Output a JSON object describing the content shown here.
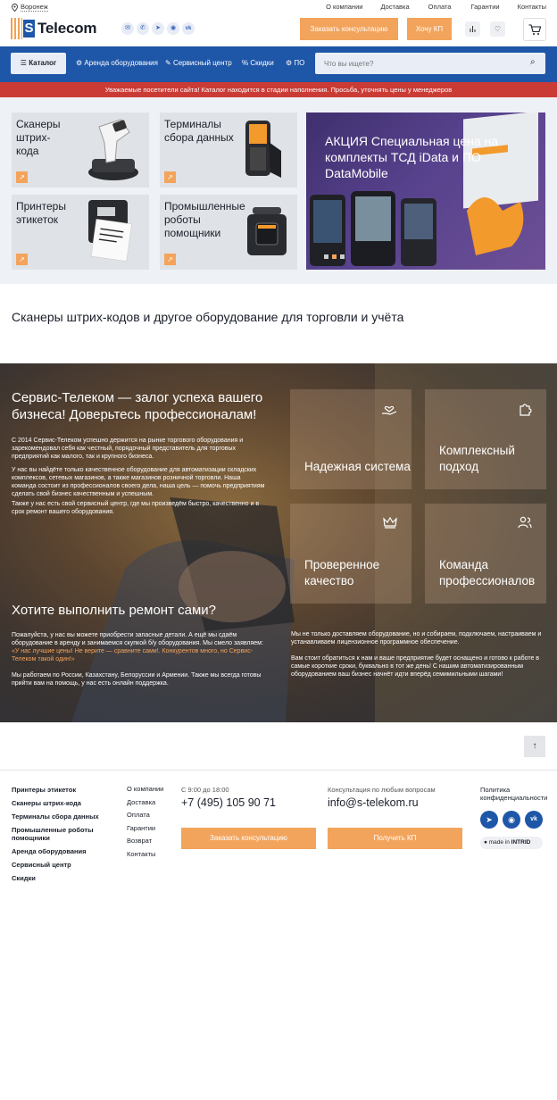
{
  "topbar": {
    "city": "Воронеж",
    "links": [
      "О компании",
      "Доставка",
      "Оплата",
      "Гарантии",
      "Контакты"
    ]
  },
  "header": {
    "logo_s": "S",
    "logo_text": "Telecom",
    "social_icons": [
      "mail-icon",
      "viber-icon",
      "telegram-icon",
      "whatsapp-icon",
      "vk-icon"
    ],
    "consult_button": "Заказать консультацию",
    "kp_button": "Хочу КП"
  },
  "nav": {
    "catalog": "Каталог",
    "items": [
      "Аренда оборудования",
      "Сервисный центр",
      "Скидки",
      "ПО"
    ],
    "search_placeholder": "Что вы ищете?"
  },
  "notice": "Уважаемые посетители сайта! Каталог находится в стадии наполнения. Просьба, уточнять цены у менеджеров",
  "categories": [
    {
      "title": "Сканеры штрих-кода"
    },
    {
      "title": "Терминалы сбора данных"
    },
    {
      "title": "Принтеры этикеток"
    },
    {
      "title": "Промышленные роботы помощники"
    }
  ],
  "promo": {
    "title": "АКЦИЯ Специальная цена на комплекты ТСД iData и ПО DataMobile",
    "slides": 3,
    "active_slide": 2
  },
  "tagline": "Сканеры штрих-кодов и другое оборудование для торговли и учёта",
  "about": {
    "hero": "Сервис-Телеком — залог успеха вашего бизнеса! Доверьтесь профессионалам!",
    "p1": "С 2014 Сервис-Телеком успешно держится на рынке торгового оборудования и зарекомендовал себя как честный, порядочный представитель для торговых предприятий как малого, так и крупного бизнеса.",
    "p2": "У нас вы найдёте только качественное оборудование для автоматизации складских комплексов, сетевых магазинов, а также магазинов розничной торговли. Наша команда состоит из профессионалов своего дела, наша цель — помочь предприятиям сделать свой бизнес качественным и успешным.",
    "p3": "Также у нас есть свой сервисный центр, где мы произведём быстро, качественно и в срок ремонт вашего оборудования.",
    "repair_title": "Хотите выполнить ремонт сами?",
    "repair_p1_a": "Пожалуйста, у нас вы можете приобрести запасные детали.    А ещё мы сдаём оборудование в аренду и занимаемся скупкой б/у оборудования. Мы смело заявляем: ",
    "repair_p1_b": "«У нас лучшие цены! Не верите — сравните сами!. Конкурентов много, но Сервис-Телеком такой один!»",
    "repair_p2": "Мы работаем по России, Казахстану, Белоруссии и Армении. Также мы всегда готовы прийти вам на помощь, у нас есть онлайн поддержка.",
    "cards": [
      {
        "title": "Надежная система",
        "icon": "hand-heart-icon"
      },
      {
        "title": "Комплексный подход",
        "icon": "puzzle-icon"
      },
      {
        "title": "Проверенное качество",
        "icon": "crown-icon"
      },
      {
        "title": "Команда профессионалов",
        "icon": "users-icon"
      }
    ],
    "r1": "Мы не только доставляем оборудование, но и собираем, подключаем, настраиваем и устанавливаем лицензионное программное обеспечение.",
    "r2": "Вам стоит обратиться к нам и ваше предприятие будет оснащено и готово к работе в самые короткие сроки, буквально в тот же день! С нашим автоматизированным оборудованием ваш бизнес начнёт идти вперёд семимильными шагами!"
  },
  "footer": {
    "catalog": [
      "Принтеры этикеток",
      "Сканеры штрих-кода",
      "Терминалы сбора данных",
      "Промышленные роботы помощники",
      "Аренда оборудования",
      "Сервисный центр",
      "Скидки"
    ],
    "pages": [
      "О компании",
      "Доставка",
      "Оплата",
      "Гарантии",
      "Возврат",
      "Контакты"
    ],
    "hours": "С 9:00 до 18:00",
    "phone": "+7 (495) 105 90 71",
    "consult_label": "Консультация по любым вопросам",
    "email": "info@s-telekom.ru",
    "consult_button": "Заказать консультацию",
    "kp_button": "Получить КП",
    "policy": "Политика конфиденциальности",
    "made_in": "made in",
    "made_brand": "INTRID"
  },
  "colors": {
    "brand_blue": "#1e56a8",
    "accent_orange": "#f3a45c",
    "notice_red": "#cb3b35"
  }
}
